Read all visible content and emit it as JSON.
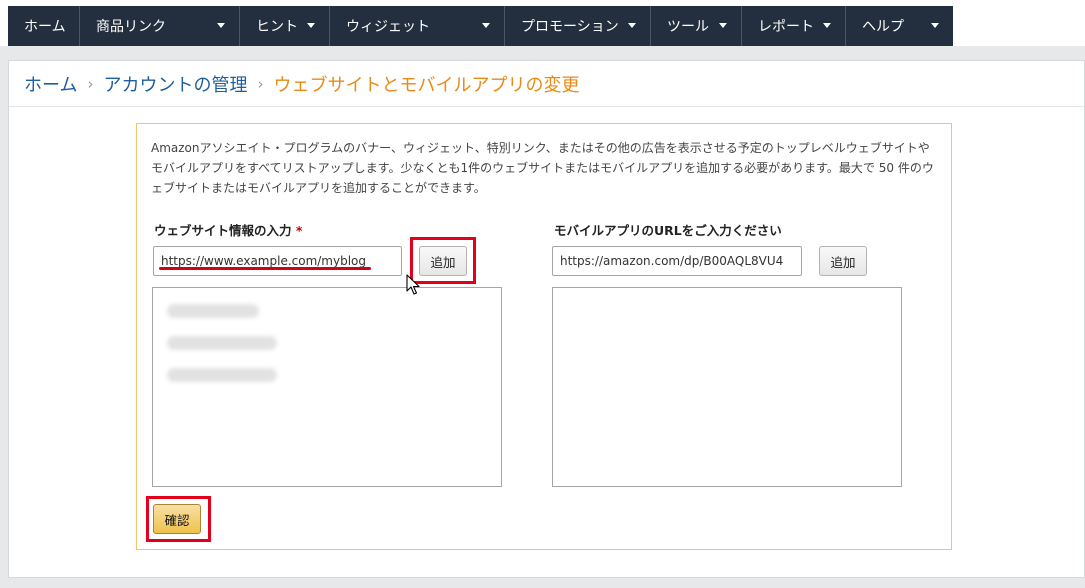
{
  "nav": {
    "items": [
      {
        "label": "ホーム",
        "has_dropdown": false
      },
      {
        "label": "商品リンク",
        "has_dropdown": true
      },
      {
        "label": "ヒント",
        "has_dropdown": true
      },
      {
        "label": "ウィジェット",
        "has_dropdown": true
      },
      {
        "label": "プロモーション",
        "has_dropdown": true
      },
      {
        "label": "ツール",
        "has_dropdown": true
      },
      {
        "label": "レポート",
        "has_dropdown": true
      },
      {
        "label": "ヘルプ",
        "has_dropdown": true
      }
    ]
  },
  "breadcrumb": {
    "home": "ホーム",
    "account": "アカウントの管理",
    "separator": "›",
    "current": "ウェブサイトとモバイルアプリの変更"
  },
  "form": {
    "description": "Amazonアソシエイト・プログラムのバナー、ウィジェット、特別リンク、またはその他の広告を表示させる予定のトップレベルウェブサイトやモバイルアプリをすべてリストアップします。少なくとも1件のウェブサイトまたはモバイルアプリを追加する必要があります。最大で 50 件のウェブサイトまたはモバイルアプリを追加することができます。",
    "website": {
      "label": "ウェブサイト情報の入力",
      "required_mark": "*",
      "value": "https://www.example.com/myblog",
      "add_label": "追加"
    },
    "app": {
      "label": "モバイルアプリのURLをご入力ください",
      "value": "https://amazon.com/dp/B00AQL8VU4",
      "add_label": "追加"
    },
    "confirm_label": "確認"
  },
  "colors": {
    "nav_bg": "#232f3e",
    "link": "#1f5f9e",
    "current": "#e88b16",
    "highlight": "#e3001b",
    "confirm_bg": "#f0c14b"
  }
}
